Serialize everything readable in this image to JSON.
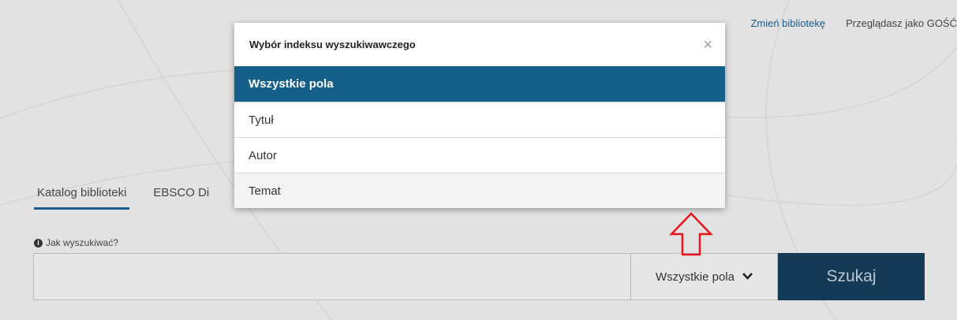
{
  "header": {
    "change_library": "Zmień bibliotekę",
    "guest_status": "Przeglądasz jako GOŚĆ"
  },
  "tabs": [
    {
      "label": "Katalog biblioteki",
      "active": true
    },
    {
      "label": "EBSCO Di",
      "active": false
    }
  ],
  "help": {
    "icon": "info-icon",
    "label": "Jak wyszukiwać?"
  },
  "search": {
    "placeholder": "",
    "index_selected": "Wszystkie pola",
    "button_label": "Szukaj"
  },
  "modal": {
    "title": "Wybór indeksu wyszukiwawczego",
    "close_symbol": "×",
    "options": [
      {
        "label": "Wszystkie pola",
        "selected": true
      },
      {
        "label": "Tytuł",
        "selected": false
      },
      {
        "label": "Autor",
        "selected": false
      },
      {
        "label": "Temat",
        "selected": false,
        "hovered": true
      }
    ]
  },
  "colors": {
    "accent": "#155f8b",
    "search_button": "#153a56",
    "annotation_arrow": "#e8141c"
  }
}
